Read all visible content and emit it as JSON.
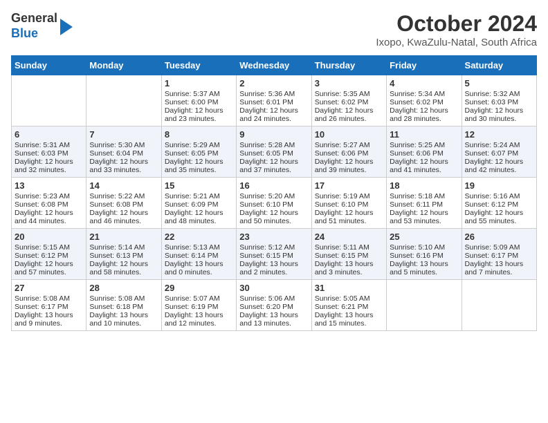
{
  "header": {
    "logo_line1": "General",
    "logo_line2": "Blue",
    "title": "October 2024",
    "subtitle": "Ixopo, KwaZulu-Natal, South Africa"
  },
  "days_of_week": [
    "Sunday",
    "Monday",
    "Tuesday",
    "Wednesday",
    "Thursday",
    "Friday",
    "Saturday"
  ],
  "weeks": [
    [
      {
        "day": "",
        "info": ""
      },
      {
        "day": "",
        "info": ""
      },
      {
        "day": "1",
        "info": "Sunrise: 5:37 AM\nSunset: 6:00 PM\nDaylight: 12 hours and 23 minutes."
      },
      {
        "day": "2",
        "info": "Sunrise: 5:36 AM\nSunset: 6:01 PM\nDaylight: 12 hours and 24 minutes."
      },
      {
        "day": "3",
        "info": "Sunrise: 5:35 AM\nSunset: 6:02 PM\nDaylight: 12 hours and 26 minutes."
      },
      {
        "day": "4",
        "info": "Sunrise: 5:34 AM\nSunset: 6:02 PM\nDaylight: 12 hours and 28 minutes."
      },
      {
        "day": "5",
        "info": "Sunrise: 5:32 AM\nSunset: 6:03 PM\nDaylight: 12 hours and 30 minutes."
      }
    ],
    [
      {
        "day": "6",
        "info": "Sunrise: 5:31 AM\nSunset: 6:03 PM\nDaylight: 12 hours and 32 minutes."
      },
      {
        "day": "7",
        "info": "Sunrise: 5:30 AM\nSunset: 6:04 PM\nDaylight: 12 hours and 33 minutes."
      },
      {
        "day": "8",
        "info": "Sunrise: 5:29 AM\nSunset: 6:05 PM\nDaylight: 12 hours and 35 minutes."
      },
      {
        "day": "9",
        "info": "Sunrise: 5:28 AM\nSunset: 6:05 PM\nDaylight: 12 hours and 37 minutes."
      },
      {
        "day": "10",
        "info": "Sunrise: 5:27 AM\nSunset: 6:06 PM\nDaylight: 12 hours and 39 minutes."
      },
      {
        "day": "11",
        "info": "Sunrise: 5:25 AM\nSunset: 6:06 PM\nDaylight: 12 hours and 41 minutes."
      },
      {
        "day": "12",
        "info": "Sunrise: 5:24 AM\nSunset: 6:07 PM\nDaylight: 12 hours and 42 minutes."
      }
    ],
    [
      {
        "day": "13",
        "info": "Sunrise: 5:23 AM\nSunset: 6:08 PM\nDaylight: 12 hours and 44 minutes."
      },
      {
        "day": "14",
        "info": "Sunrise: 5:22 AM\nSunset: 6:08 PM\nDaylight: 12 hours and 46 minutes."
      },
      {
        "day": "15",
        "info": "Sunrise: 5:21 AM\nSunset: 6:09 PM\nDaylight: 12 hours and 48 minutes."
      },
      {
        "day": "16",
        "info": "Sunrise: 5:20 AM\nSunset: 6:10 PM\nDaylight: 12 hours and 50 minutes."
      },
      {
        "day": "17",
        "info": "Sunrise: 5:19 AM\nSunset: 6:10 PM\nDaylight: 12 hours and 51 minutes."
      },
      {
        "day": "18",
        "info": "Sunrise: 5:18 AM\nSunset: 6:11 PM\nDaylight: 12 hours and 53 minutes."
      },
      {
        "day": "19",
        "info": "Sunrise: 5:16 AM\nSunset: 6:12 PM\nDaylight: 12 hours and 55 minutes."
      }
    ],
    [
      {
        "day": "20",
        "info": "Sunrise: 5:15 AM\nSunset: 6:12 PM\nDaylight: 12 hours and 57 minutes."
      },
      {
        "day": "21",
        "info": "Sunrise: 5:14 AM\nSunset: 6:13 PM\nDaylight: 12 hours and 58 minutes."
      },
      {
        "day": "22",
        "info": "Sunrise: 5:13 AM\nSunset: 6:14 PM\nDaylight: 13 hours and 0 minutes."
      },
      {
        "day": "23",
        "info": "Sunrise: 5:12 AM\nSunset: 6:15 PM\nDaylight: 13 hours and 2 minutes."
      },
      {
        "day": "24",
        "info": "Sunrise: 5:11 AM\nSunset: 6:15 PM\nDaylight: 13 hours and 3 minutes."
      },
      {
        "day": "25",
        "info": "Sunrise: 5:10 AM\nSunset: 6:16 PM\nDaylight: 13 hours and 5 minutes."
      },
      {
        "day": "26",
        "info": "Sunrise: 5:09 AM\nSunset: 6:17 PM\nDaylight: 13 hours and 7 minutes."
      }
    ],
    [
      {
        "day": "27",
        "info": "Sunrise: 5:08 AM\nSunset: 6:17 PM\nDaylight: 13 hours and 9 minutes."
      },
      {
        "day": "28",
        "info": "Sunrise: 5:08 AM\nSunset: 6:18 PM\nDaylight: 13 hours and 10 minutes."
      },
      {
        "day": "29",
        "info": "Sunrise: 5:07 AM\nSunset: 6:19 PM\nDaylight: 13 hours and 12 minutes."
      },
      {
        "day": "30",
        "info": "Sunrise: 5:06 AM\nSunset: 6:20 PM\nDaylight: 13 hours and 13 minutes."
      },
      {
        "day": "31",
        "info": "Sunrise: 5:05 AM\nSunset: 6:21 PM\nDaylight: 13 hours and 15 minutes."
      },
      {
        "day": "",
        "info": ""
      },
      {
        "day": "",
        "info": ""
      }
    ]
  ]
}
